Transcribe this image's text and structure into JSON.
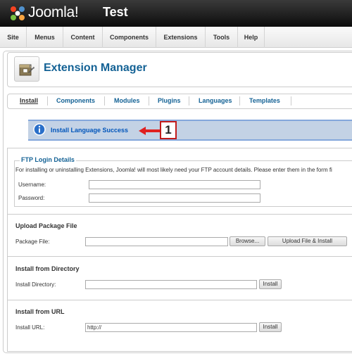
{
  "header": {
    "brand": "Joomla!",
    "site_name": "Test"
  },
  "menu": [
    {
      "label": "Site"
    },
    {
      "label": "Menus"
    },
    {
      "label": "Content"
    },
    {
      "label": "Components"
    },
    {
      "label": "Extensions"
    },
    {
      "label": "Tools"
    },
    {
      "label": "Help"
    }
  ],
  "page": {
    "title": "Extension Manager"
  },
  "submenu": [
    {
      "label": "Install",
      "active": true
    },
    {
      "label": "Components"
    },
    {
      "label": "Modules"
    },
    {
      "label": "Plugins"
    },
    {
      "label": "Languages"
    },
    {
      "label": "Templates"
    }
  ],
  "message": {
    "text": "Install Language Success",
    "annotation_number": "1"
  },
  "ftp": {
    "legend": "FTP Login Details",
    "description": "For installing or uninstalling Extensions, Joomla! will most likely need your FTP account details. Please enter them in the form fi",
    "username_label": "Username:",
    "username_value": "",
    "password_label": "Password:",
    "password_value": ""
  },
  "upload": {
    "title": "Upload Package File",
    "label": "Package File:",
    "value": "",
    "browse_label": "Browse...",
    "submit_label": "Upload File & Install"
  },
  "directory": {
    "title": "Install from Directory",
    "label": "Install Directory:",
    "value": "",
    "button_label": "Install"
  },
  "url": {
    "title": "Install from URL",
    "label": "Install URL:",
    "value": "http://",
    "button_label": "Install"
  }
}
